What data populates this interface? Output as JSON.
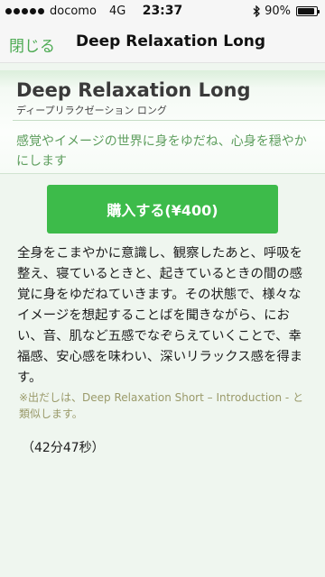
{
  "status_bar": {
    "carrier": "docomo",
    "network": "4G",
    "time": "23:37",
    "battery": "90%",
    "battery_level": 0.9
  },
  "nav": {
    "close_label": "閉じる",
    "title": "Deep Relaxation Long"
  },
  "header": {
    "title_en": "Deep Relaxation Long",
    "title_ja": "ディープリラクゼーション ロング",
    "tagline": "感覚やイメージの世界に身をゆだね、心身を穏やかにします"
  },
  "buy_button": {
    "label": "購入する(¥400)"
  },
  "description": "全身をこまやかに意識し、観察したあと、呼吸を整え、寝ているときと、起きているときの間の感覚に身をゆだねていきます。その状態で、様々なイメージを想起することばを聞きながら、におい、音、肌など五感でなぞらえていくことで、幸福感、安心感を味わい、深いリラックス感を得ます。",
  "note": "※出だしは、Deep Relaxation Short – Introduction - と類似します。",
  "duration": "（42分47秒）",
  "colors": {
    "accent": "#4caa52",
    "button": "#3dbb4a",
    "background": "#eff6ef",
    "tagline": "#5e9e5e",
    "note": "#9a9a6a"
  }
}
